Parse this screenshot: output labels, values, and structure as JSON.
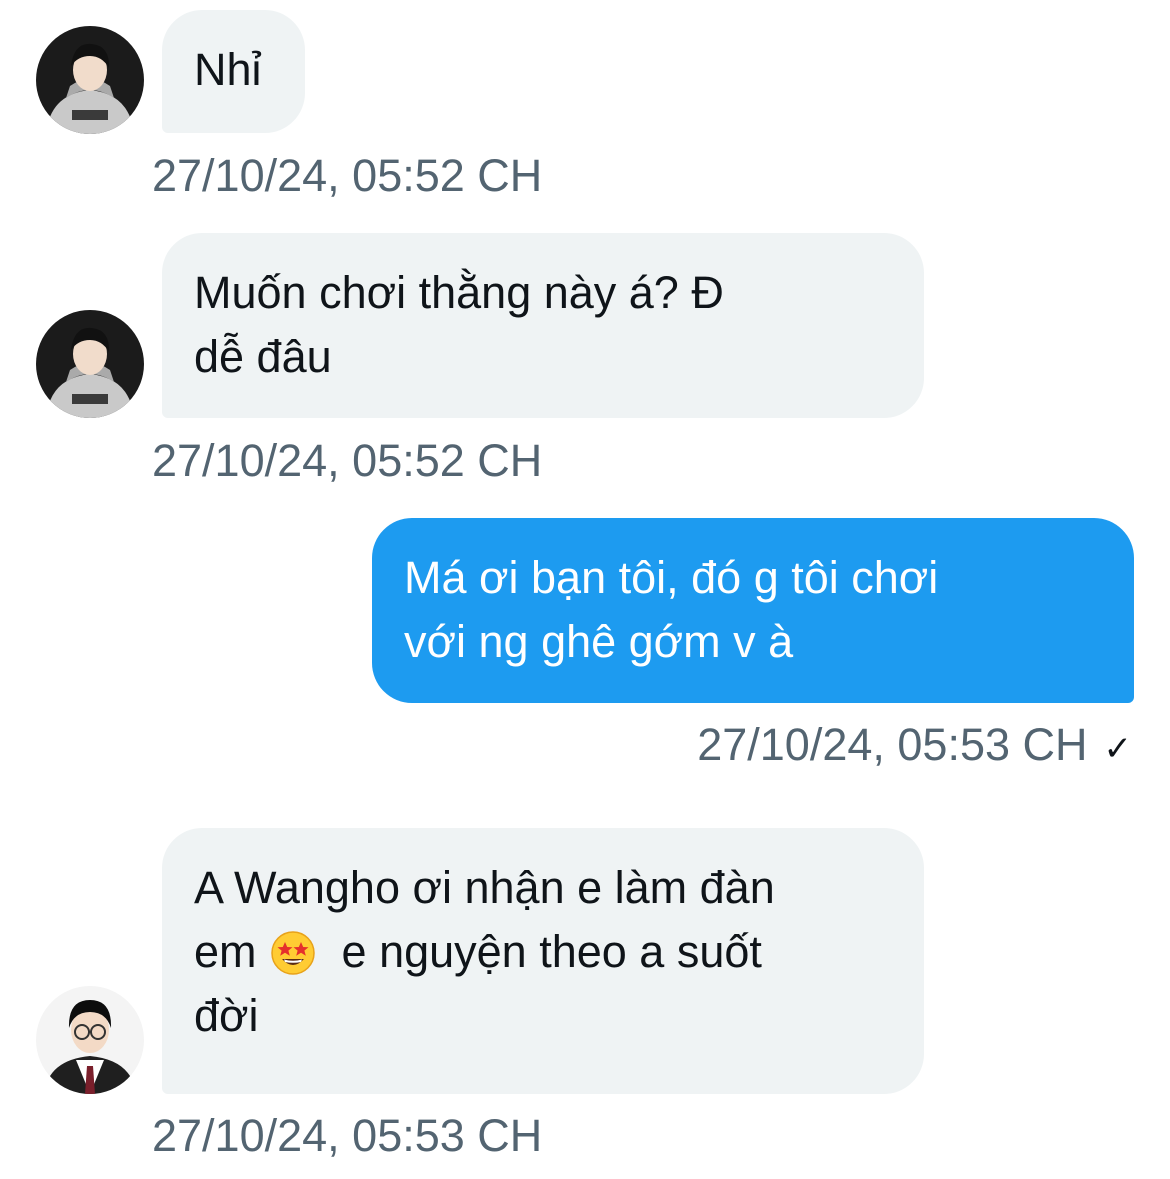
{
  "colors": {
    "incoming_bubble": "#eff3f4",
    "outgoing_bubble": "#1d9bf0",
    "timestamp": "#536471"
  },
  "messages": [
    {
      "direction": "incoming",
      "avatar": "avatar-hoodie-user",
      "text": "Nhỉ",
      "time": "27/10/24, 05:52 CH"
    },
    {
      "direction": "incoming",
      "avatar": "avatar-hoodie-user",
      "lines": [
        "Muốn chơi thằng này á? Đ",
        "dễ đâu"
      ],
      "time": "27/10/24, 05:52 CH"
    },
    {
      "direction": "outgoing",
      "lines": [
        "Má ơi bạn tôi, đó g tôi chơi",
        "với ng ghê gớm v à"
      ],
      "time": "27/10/24, 05:53 CH",
      "status_icon": "check-icon",
      "status_glyph": "✓"
    },
    {
      "direction": "incoming",
      "avatar": "avatar-glasses-user",
      "line1": "A Wangho ơi nhận e làm đàn",
      "line2_before_emoji": "em",
      "emoji": "star-struck-emoji",
      "line2_after_emoji": "e nguyện theo a suốt",
      "line3": "đời",
      "time": "27/10/24, 05:53 CH"
    }
  ]
}
